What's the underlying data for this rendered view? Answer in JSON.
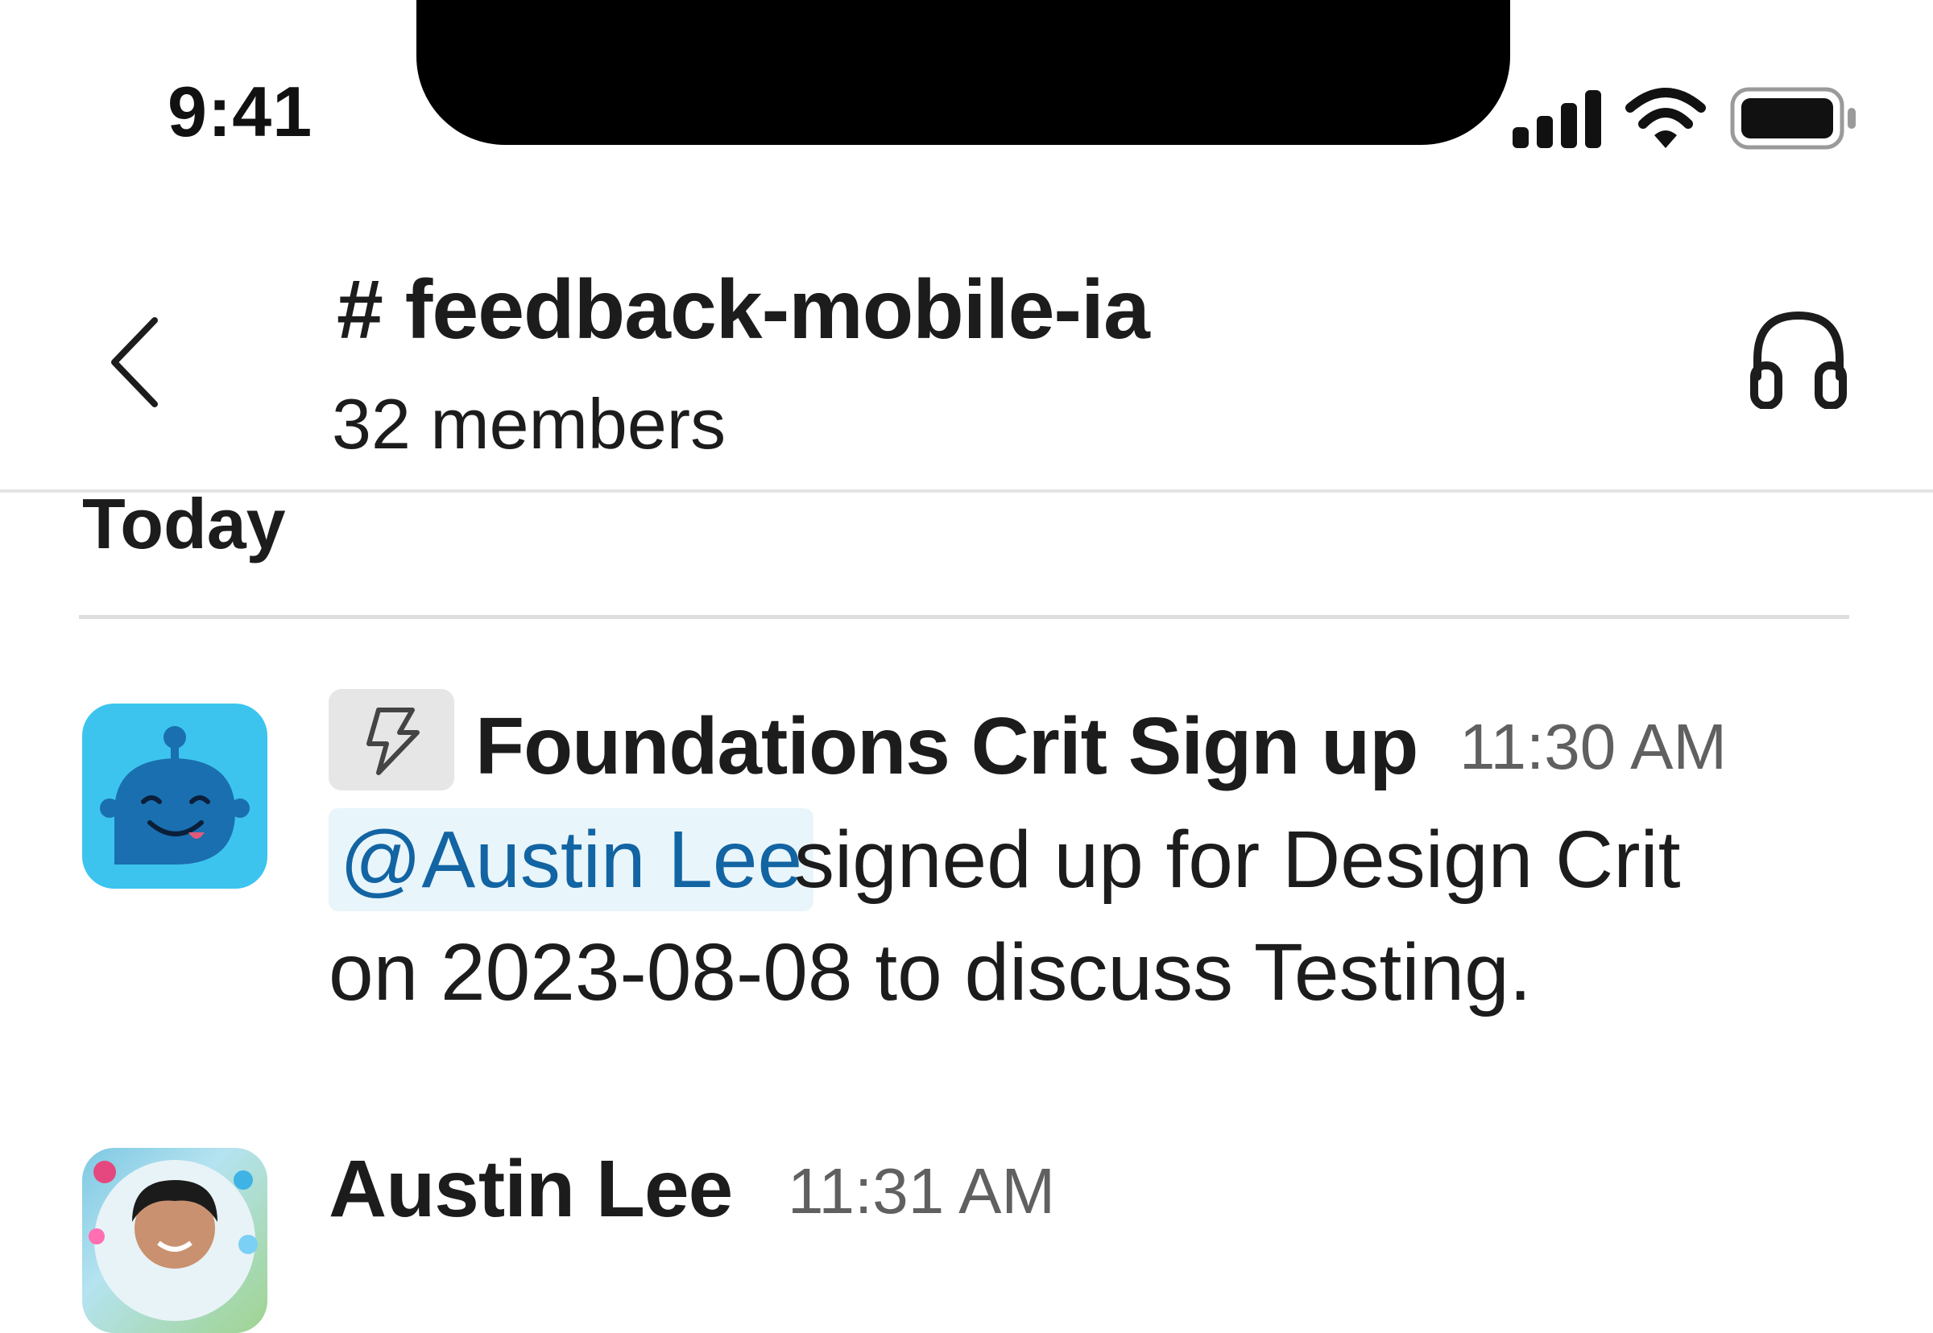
{
  "status_bar": {
    "time": "9:41"
  },
  "header": {
    "channel_name": "# feedback-mobile-ia",
    "member_count": "32 members"
  },
  "day_divider": {
    "label": "Today"
  },
  "messages": [
    {
      "sender": "Foundations Crit Sign up",
      "time": "11:30 AM",
      "mention": "@Austin Lee",
      "text_line1": "signed up for Design Crit",
      "text_line2": "on 2023-08-08 to discuss Testing."
    },
    {
      "sender": "Austin Lee",
      "time": "11:31 AM"
    }
  ],
  "icons": {
    "back": "chevron-left-icon",
    "huddle": "headphones-icon",
    "workflow": "lightning-bolt-icon",
    "signal": "cellular-signal-icon",
    "wifi": "wifi-icon",
    "battery": "battery-icon"
  },
  "colors": {
    "mention_text": "#1264a3",
    "mention_bg": "#e8f5fa",
    "bot_avatar": "#3cc4ee",
    "timestamp": "#616061"
  }
}
